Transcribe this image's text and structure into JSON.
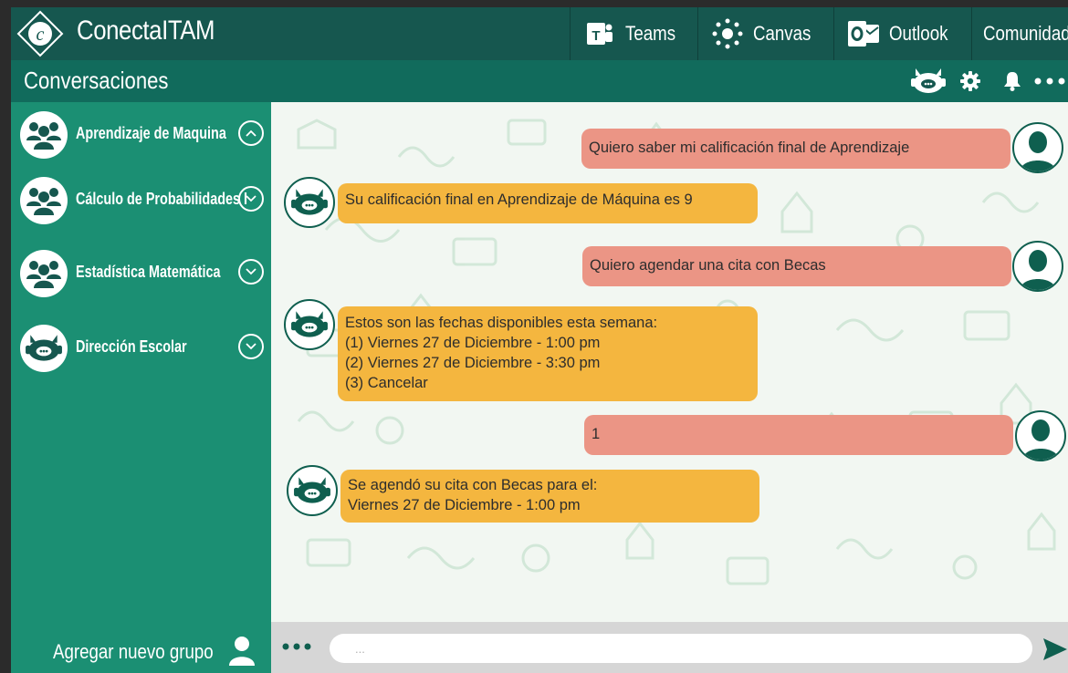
{
  "app": {
    "brand": "ConectaITAM"
  },
  "topnav": {
    "apps": [
      {
        "label": "Teams",
        "icon": "teams-icon"
      },
      {
        "label": "Canvas",
        "icon": "canvas-icon"
      },
      {
        "label": "Outlook",
        "icon": "outlook-icon"
      },
      {
        "label": "Comunidad ITAM",
        "icon": ""
      }
    ]
  },
  "header": {
    "title": "Conversaciones",
    "tools": [
      "bot-icon",
      "gear-icon",
      "bell-icon",
      "more-icon"
    ]
  },
  "sidebar": {
    "groups": [
      {
        "name": "Aprendizaje de Maquina",
        "icon": "group-icon",
        "expanded": true
      },
      {
        "name": "Cálculo de Probabilidades I",
        "icon": "group-icon",
        "expanded": false
      },
      {
        "name": "Estadística Matemática",
        "icon": "group-icon",
        "expanded": false
      },
      {
        "name": "Dirección Escolar",
        "icon": "bot-icon",
        "expanded": false
      }
    ],
    "add_group_label": "Agregar nuevo grupo"
  },
  "messages": [
    {
      "from": "user",
      "text": "Quiero saber mi calificación final de Aprendizaje"
    },
    {
      "from": "bot",
      "text": "Su calificación final en Aprendizaje de Máquina es 9"
    },
    {
      "from": "user",
      "text": "Quiero agendar una cita con Becas"
    },
    {
      "from": "bot",
      "text": "Estos son las fechas disponibles esta semana:\n(1) Viernes 27 de Diciembre - 1:00 pm\n(2) Viernes 27 de Diciembre - 3:30 pm\n(3) Cancelar"
    },
    {
      "from": "user",
      "text": "1"
    },
    {
      "from": "bot",
      "text": "Se agendó su cita con Becas para el:\nViernes 27 de Diciembre - 1:00 pm"
    }
  ],
  "composer": {
    "placeholder": "...",
    "value": ""
  },
  "colors": {
    "topbar": "#16574f",
    "subbar": "#116b5c",
    "sidebar": "#1b8f73",
    "user_bubble": "#eb9585",
    "bot_bubble": "#f4b63f"
  }
}
